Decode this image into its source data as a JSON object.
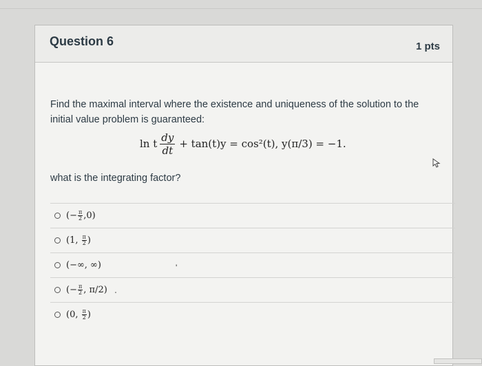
{
  "question": {
    "title": "Question 6",
    "points": "1 pts",
    "prompt": "Find the maximal interval where the existence and uniqueness of the solution to the initial value problem is guaranteed:",
    "equation": {
      "lhs_prefix": "ln t",
      "frac_num": "dy",
      "frac_den": "dt",
      "rest": "+ tan(t)y = cos²(t), y(π/3) = −1."
    },
    "sub_question": "what is the integrating factor?"
  },
  "answers": [
    {
      "open": "(−",
      "num": "π",
      "den": "2",
      "sep": ",",
      "tail": " 0)"
    },
    {
      "open": "(1,",
      "num": "π",
      "den": "2",
      "sep": "",
      "tail": ")"
    },
    {
      "open": "(−∞, ∞)",
      "num": "",
      "den": "",
      "sep": "",
      "tail": ""
    },
    {
      "open": "(−",
      "num": "π",
      "den": "2",
      "sep": ",",
      "tail": "π/2)"
    },
    {
      "open": "(0,",
      "num": "π",
      "den": "2",
      "sep": "",
      "tail": ")"
    }
  ],
  "icons": {
    "radio": "radio-button-icon",
    "cursor": "mouse-cursor-icon"
  }
}
